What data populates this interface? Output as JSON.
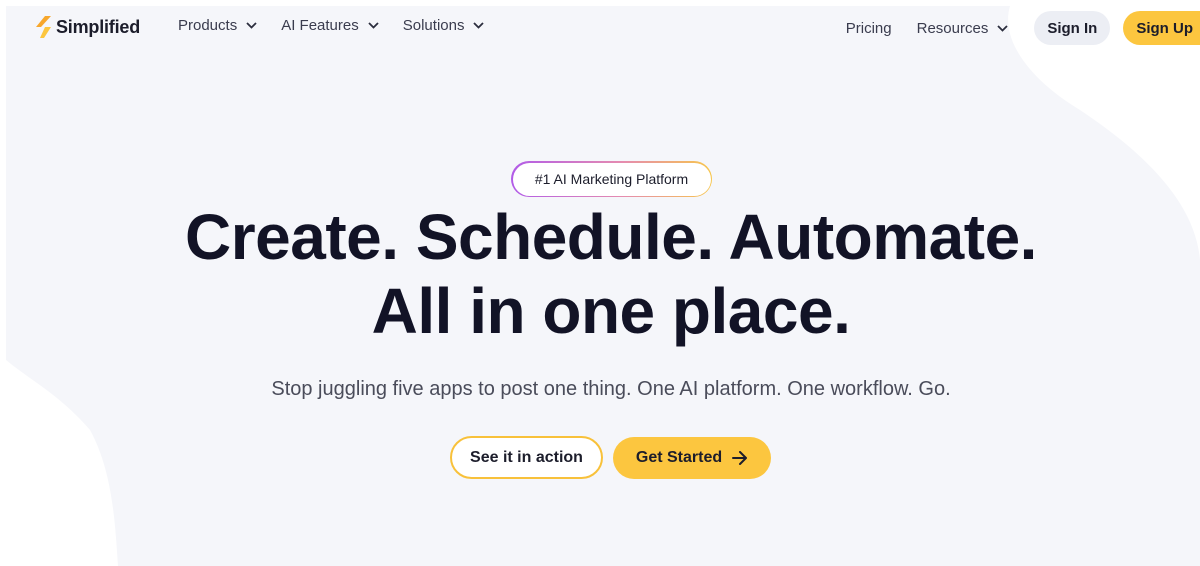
{
  "colors": {
    "accent": "#fcc63f",
    "background_shape": "#f5f6fa",
    "text_dark": "#121326",
    "badge_gradient": [
      "#b15be8",
      "#e58bb0",
      "#f7c64c"
    ]
  },
  "nav": {
    "logo": {
      "text": "Simplified",
      "icon": "simplified-logo-icon"
    },
    "menu": [
      {
        "label": "Products",
        "icon": "chevron-down-icon"
      },
      {
        "label": "AI Features",
        "icon": "chevron-down-icon"
      },
      {
        "label": "Solutions",
        "icon": "chevron-down-icon"
      }
    ],
    "pricing": "Pricing",
    "resources": {
      "label": "Resources",
      "icon": "chevron-down-icon"
    },
    "sign_in": "Sign In",
    "sign_up": "Sign Up"
  },
  "hero": {
    "badge": "#1 AI Marketing Platform",
    "headline_line1": "Create. Schedule. Automate.",
    "headline_line2": "All in one place.",
    "subtitle": "Stop juggling five apps to post one thing. One AI platform. One workflow. Go.",
    "cta_secondary": "See it in action",
    "cta_primary": {
      "label": "Get Started",
      "icon": "arrow-right-icon"
    }
  }
}
